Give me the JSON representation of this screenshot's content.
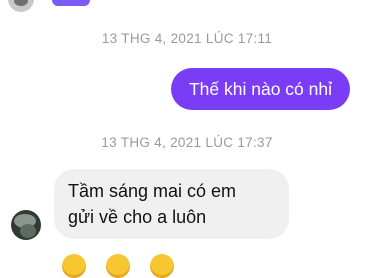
{
  "messages": [
    {
      "timestamp": "13 THG 4, 2021 LÚC 17:11",
      "outgoing_text": "Thế khi nào có nhỉ"
    },
    {
      "timestamp": "13 THG 4, 2021 LÚC 17:37",
      "incoming_lines": [
        "Tầm sáng mai có em",
        "gửi về cho a luôn"
      ]
    }
  ],
  "colors": {
    "outgoing_bubble": "#7a3cf5",
    "incoming_bubble": "#f0f0f0",
    "timestamp_text": "#9a9aa0"
  },
  "icons": [
    "sender-avatar",
    "emoji-reaction"
  ]
}
